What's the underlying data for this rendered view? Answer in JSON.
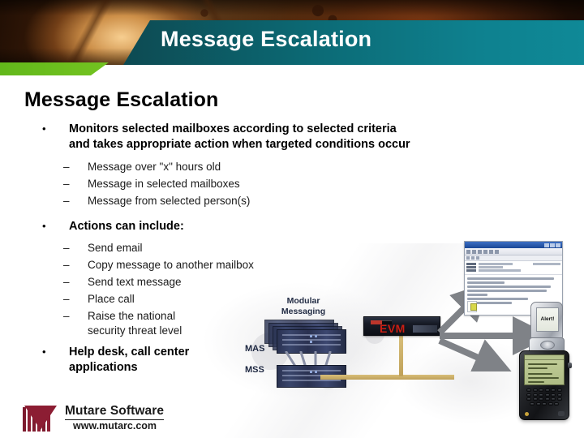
{
  "slide": {
    "header_title": "Message Escalation",
    "body_heading": "Message Escalation"
  },
  "bullets": [
    {
      "bullet": "•",
      "text_line1": "Monitors selected mailboxes according to selected criteria",
      "text_line2": "and takes appropriate action when targeted conditions occur",
      "sub": [
        "Message over \"x\" hours old",
        "Message in selected mailboxes",
        "Message from selected person(s)"
      ]
    },
    {
      "bullet": "•",
      "text_line1": "Actions can include:",
      "text_line2": "",
      "sub": [
        "Send email",
        "Copy message to another mailbox",
        "Send text message",
        "Place call",
        "Raise the national",
        "security threat level"
      ]
    },
    {
      "bullet": "•",
      "text_line1": "Help desk, call center",
      "text_line2": "applications",
      "sub": []
    }
  ],
  "dash": "–",
  "diagram": {
    "modular_messaging_line1": "Modular",
    "modular_messaging_line2": "Messaging",
    "mas_label": "MAS",
    "mss_label": "MSS",
    "evm_label": "EVM",
    "phone_alert_text": "Alert!"
  },
  "logo": {
    "company": "Mutare Software",
    "url": "www.mutarc.com"
  },
  "colors": {
    "banner_dark_teal": "#0c3a41",
    "banner_light_teal": "#0f8997",
    "accent_green": "#6fc01f",
    "logo_maroon": "#8c1d33",
    "evm_red": "#cc1f14",
    "server_navy": "#2b3352"
  }
}
